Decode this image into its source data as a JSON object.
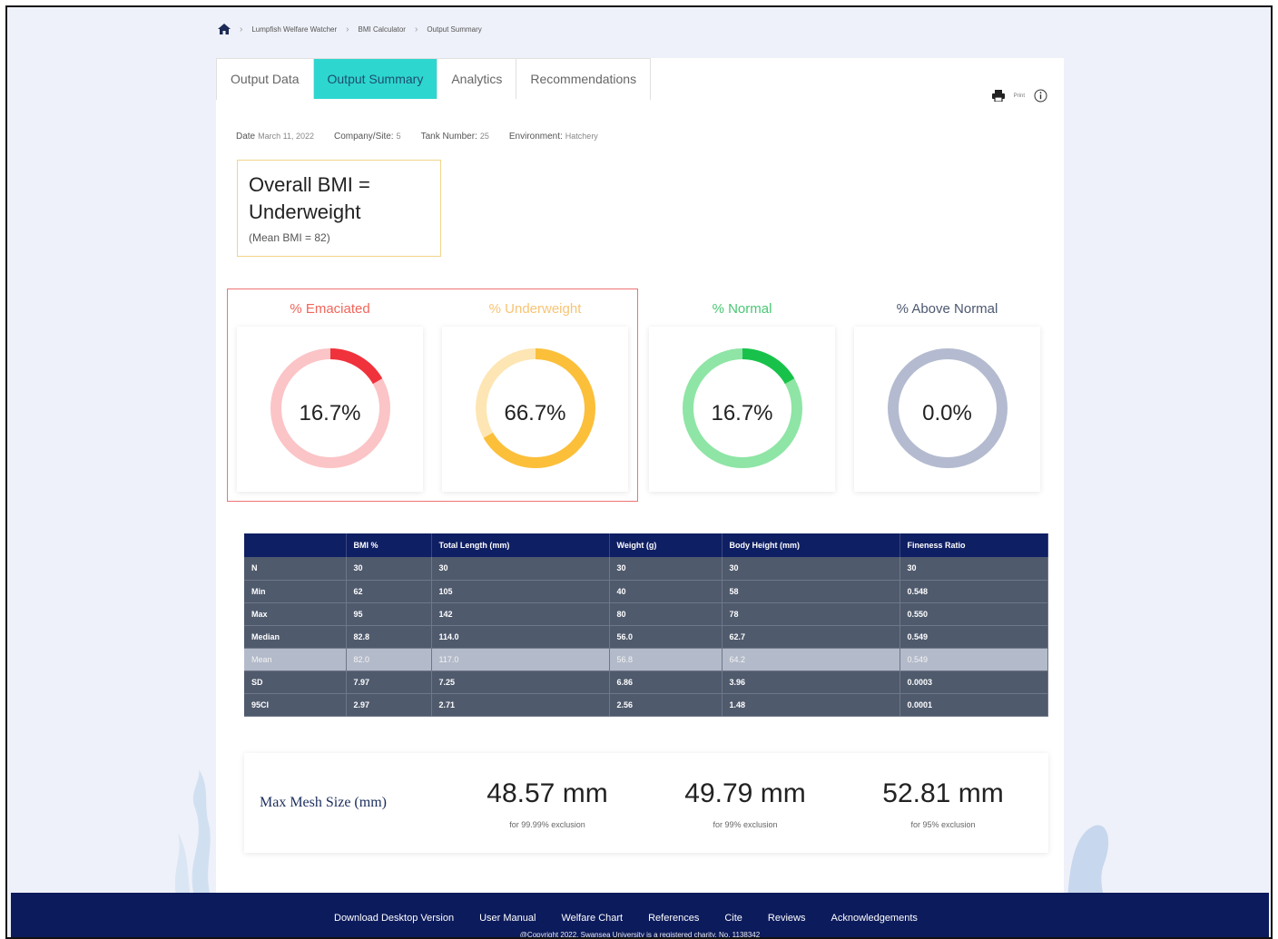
{
  "breadcrumb": {
    "items": [
      "Lumpfish Welfare Watcher",
      "BMI Calculator",
      "Output Summary"
    ]
  },
  "tabs": [
    {
      "label": "Output Data"
    },
    {
      "label": "Output Summary"
    },
    {
      "label": "Analytics"
    },
    {
      "label": "Recommendations"
    }
  ],
  "toolbar": {
    "print_label": "Print"
  },
  "meta": {
    "date_label": "Date",
    "date_value": "March 11, 2022",
    "company_label": "Company/Site:",
    "company_value": "5",
    "tank_label": "Tank Number:",
    "tank_value": "25",
    "env_label": "Environment:",
    "env_value": "Hatchery"
  },
  "bmi": {
    "line1": "Overall BMI =",
    "line2": "Underweight",
    "mean": "(Mean BMI = 82)"
  },
  "donuts": [
    {
      "title": "% Emaciated",
      "value": "16.7%",
      "fraction": 0.167,
      "color": "#f0323c",
      "track": "#fbc4c6",
      "title_color": "#f0665a"
    },
    {
      "title": "% Underweight",
      "value": "66.7%",
      "fraction": 0.667,
      "color": "#fbbf3a",
      "track": "#fde6b4",
      "title_color": "#f8c475"
    },
    {
      "title": "% Normal",
      "value": "16.7%",
      "fraction": 0.167,
      "color": "#18c24a",
      "track": "#8ee5a5",
      "title_color": "#4ac774"
    },
    {
      "title": "% Above Normal",
      "value": "0.0%",
      "fraction": 0.0,
      "color": "#a9b0c8",
      "track": "#b4bbd0",
      "title_color": "#4c5870"
    }
  ],
  "table": {
    "headers": [
      "",
      "BMI %",
      "Total Length (mm)",
      "Weight (g)",
      "Body Height (mm)",
      "Fineness Ratio"
    ],
    "rows": [
      [
        "N",
        "30",
        "30",
        "30",
        "30",
        "30"
      ],
      [
        "Min",
        "62",
        "105",
        "40",
        "58",
        "0.548"
      ],
      [
        "Max",
        "95",
        "142",
        "80",
        "78",
        "0.550"
      ],
      [
        "Median",
        "82.8",
        "114.0",
        "56.0",
        "62.7",
        "0.549"
      ],
      [
        "Mean",
        "82.0",
        "117.0",
        "56.8",
        "64.2",
        "0.549"
      ],
      [
        "SD",
        "7.97",
        "7.25",
        "6.86",
        "3.96",
        "0.0003"
      ],
      [
        "95CI",
        "2.97",
        "2.71",
        "2.56",
        "1.48",
        "0.0001"
      ]
    ]
  },
  "mesh": {
    "label": "Max Mesh Size (mm)",
    "items": [
      {
        "value": "48.57 mm",
        "note": "for 99.99% exclusion"
      },
      {
        "value": "49.79 mm",
        "note": "for 99% exclusion"
      },
      {
        "value": "52.81 mm",
        "note": "for 95% exclusion"
      }
    ]
  },
  "footer": {
    "links": [
      "Download Desktop Version",
      "User Manual",
      "Welfare Chart",
      "References",
      "Cite",
      "Reviews",
      "Acknowledgements"
    ],
    "copyright": "@Copyright 2022, Swansea University is a registered charity, No. 1138342"
  }
}
